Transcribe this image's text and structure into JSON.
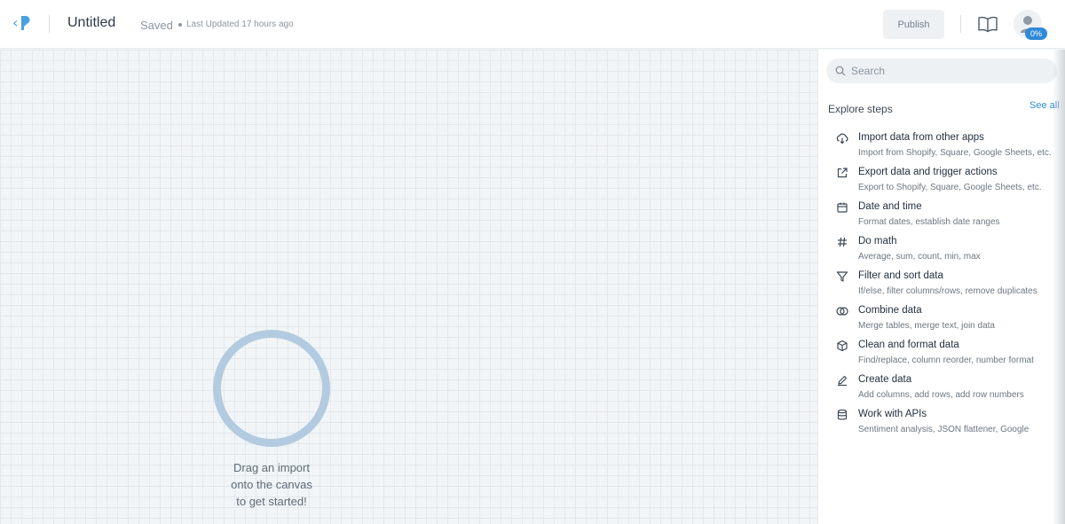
{
  "header": {
    "title": "Untitled",
    "saved": "Saved",
    "last_updated": "Last Updated 17 hours ago",
    "publish_label": "Publish",
    "progress": "0%"
  },
  "canvas": {
    "hint_line1": "Drag an import",
    "hint_line2": "onto the canvas",
    "hint_line3": "to get started!"
  },
  "sidebar": {
    "search_placeholder": "Search",
    "explore_label": "Explore steps",
    "see_all": "See all",
    "steps": [
      {
        "icon": "cloud-download-icon",
        "name": "Import data from other apps",
        "desc": "Import from Shopify, Square, Google Sheets, etc."
      },
      {
        "icon": "external-link-icon",
        "name": "Export data and trigger actions",
        "desc": "Export to Shopify, Square, Google Sheets, etc."
      },
      {
        "icon": "calendar-icon",
        "name": "Date and time",
        "desc": "Format dates, establish date ranges"
      },
      {
        "icon": "hash-icon",
        "name": "Do math",
        "desc": "Average, sum, count, min, max"
      },
      {
        "icon": "filter-icon",
        "name": "Filter and sort data",
        "desc": "If/else, filter columns/rows, remove duplicates"
      },
      {
        "icon": "combine-icon",
        "name": "Combine data",
        "desc": "Merge tables, merge text, join data"
      },
      {
        "icon": "box-icon",
        "name": "Clean and format data",
        "desc": "Find/replace, column reorder, number format"
      },
      {
        "icon": "pencil-icon",
        "name": "Create data",
        "desc": "Add columns, add rows, add row numbers"
      },
      {
        "icon": "database-icon",
        "name": "Work with APIs",
        "desc": "Sentiment analysis, JSON flattener, Google"
      }
    ]
  },
  "colors": {
    "accent": "#2f8ad7",
    "logo": "#4a9fe0",
    "ring": "#b3cbe0"
  }
}
